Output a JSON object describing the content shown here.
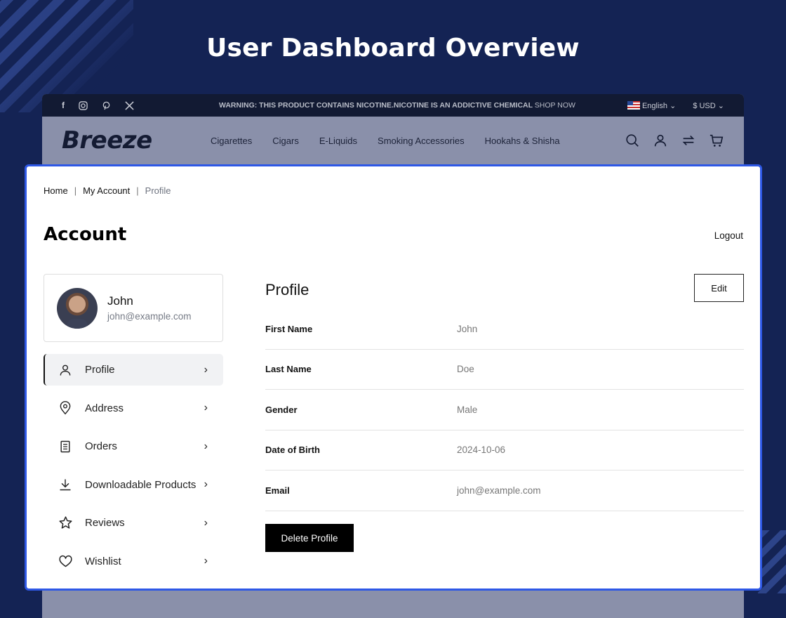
{
  "hero": {
    "title": "User Dashboard Overview"
  },
  "topbar": {
    "social": [
      "facebook-icon",
      "instagram-icon",
      "pinterest-icon",
      "x-icon"
    ],
    "warning": "WARNING: THIS PRODUCT CONTAINS NICOTINE.NICOTINE IS AN ADDICTIVE CHEMICAL",
    "shop_now": "SHOP NOW",
    "language": "English",
    "currency": "$ USD"
  },
  "navbar": {
    "logo": "Breeze",
    "links": [
      "Cigarettes",
      "Cigars",
      "E-Liquids",
      "Smoking Accessories",
      "Hookahs & Shisha"
    ],
    "icons": [
      "search-icon",
      "user-icon",
      "compare-icon",
      "cart-icon"
    ]
  },
  "breadcrumb": {
    "home": "Home",
    "account": "My Account",
    "current": "Profile",
    "sep": "|"
  },
  "account": {
    "title": "Account",
    "logout": "Logout"
  },
  "user": {
    "name": "John",
    "email": "john@example.com"
  },
  "menu": [
    {
      "label": "Profile",
      "icon": "user-icon",
      "active": true
    },
    {
      "label": "Address",
      "icon": "location-pin-icon"
    },
    {
      "label": "Orders",
      "icon": "receipt-icon"
    },
    {
      "label": "Downloadable Products",
      "icon": "download-icon"
    },
    {
      "label": "Reviews",
      "icon": "star-icon"
    },
    {
      "label": "Wishlist",
      "icon": "heart-icon"
    }
  ],
  "profile": {
    "title": "Profile",
    "edit": "Edit",
    "fields": [
      {
        "label": "First Name",
        "value": "John"
      },
      {
        "label": "Last Name",
        "value": "Doe"
      },
      {
        "label": "Gender",
        "value": "Male"
      },
      {
        "label": "Date of Birth",
        "value": "2024-10-06"
      },
      {
        "label": "Email",
        "value": "john@example.com"
      }
    ],
    "delete": "Delete Profile"
  },
  "colors": {
    "accent": "#2e58e6",
    "background": "#142354"
  }
}
